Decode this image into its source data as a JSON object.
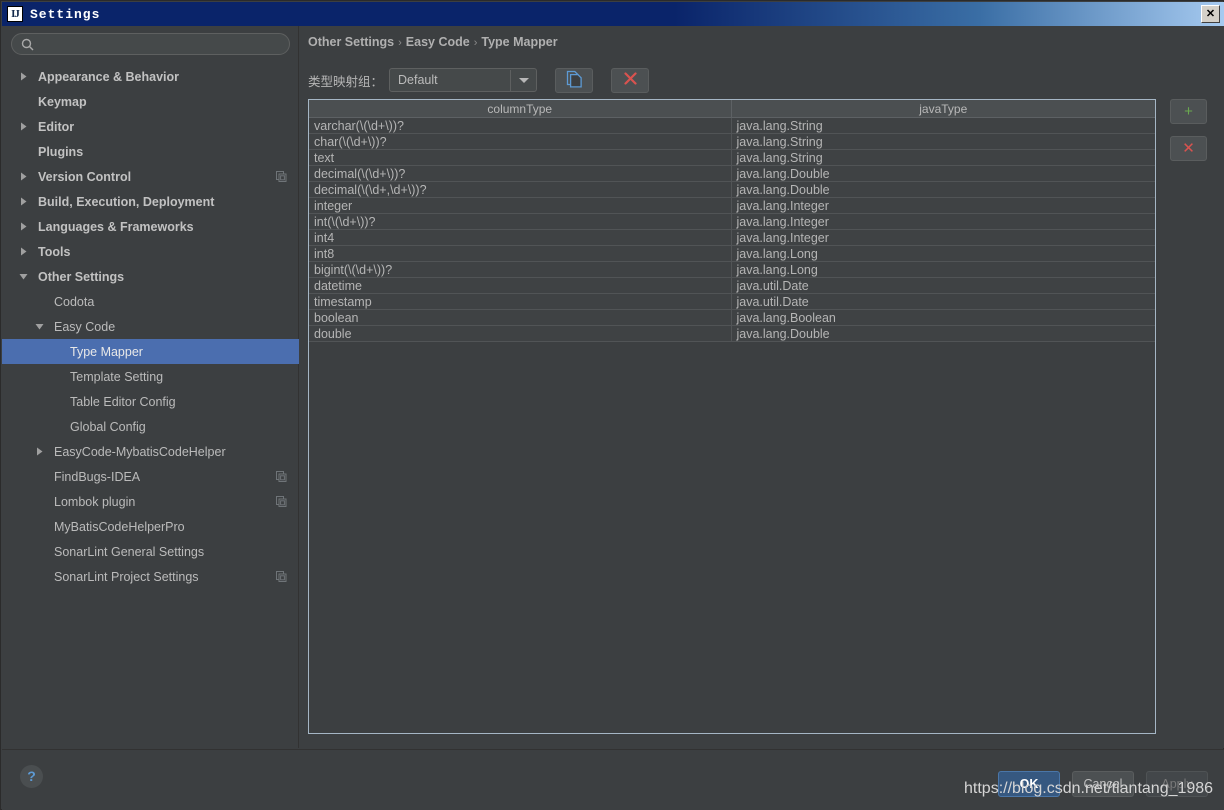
{
  "window": {
    "title": "Settings",
    "app_icon": "intellij-idea-icon",
    "close_label": "✕"
  },
  "sidebar": {
    "search": {
      "value": "",
      "placeholder": "",
      "icon": "search-icon"
    },
    "items": [
      {
        "label": "Appearance & Behavior",
        "indent": 36,
        "arrow": "collapsed",
        "bold": true,
        "badge": false
      },
      {
        "label": "Keymap",
        "indent": 36,
        "arrow": "none",
        "bold": true,
        "badge": false
      },
      {
        "label": "Editor",
        "indent": 36,
        "arrow": "collapsed",
        "bold": true,
        "badge": false
      },
      {
        "label": "Plugins",
        "indent": 36,
        "arrow": "none",
        "bold": true,
        "badge": false
      },
      {
        "label": "Version Control",
        "indent": 36,
        "arrow": "collapsed",
        "bold": true,
        "badge": true
      },
      {
        "label": "Build, Execution, Deployment",
        "indent": 36,
        "arrow": "collapsed",
        "bold": true,
        "badge": false
      },
      {
        "label": "Languages & Frameworks",
        "indent": 36,
        "arrow": "collapsed",
        "bold": true,
        "badge": false
      },
      {
        "label": "Tools",
        "indent": 36,
        "arrow": "collapsed",
        "bold": true,
        "badge": false
      },
      {
        "label": "Other Settings",
        "indent": 36,
        "arrow": "expanded",
        "bold": true,
        "badge": false
      },
      {
        "label": "Codota",
        "indent": 52,
        "arrow": "none",
        "bold": false,
        "badge": false
      },
      {
        "label": "Easy Code",
        "indent": 52,
        "arrow": "expanded",
        "bold": false,
        "badge": false
      },
      {
        "label": "Type Mapper",
        "indent": 68,
        "arrow": "none",
        "bold": false,
        "badge": false,
        "selected": true
      },
      {
        "label": "Template Setting",
        "indent": 68,
        "arrow": "none",
        "bold": false,
        "badge": false
      },
      {
        "label": "Table Editor Config",
        "indent": 68,
        "arrow": "none",
        "bold": false,
        "badge": false
      },
      {
        "label": "Global Config",
        "indent": 68,
        "arrow": "none",
        "bold": false,
        "badge": false
      },
      {
        "label": "EasyCode-MybatisCodeHelper",
        "indent": 52,
        "arrow": "collapsed",
        "bold": false,
        "badge": false
      },
      {
        "label": "FindBugs-IDEA",
        "indent": 52,
        "arrow": "none",
        "bold": false,
        "badge": true
      },
      {
        "label": "Lombok plugin",
        "indent": 52,
        "arrow": "none",
        "bold": false,
        "badge": true
      },
      {
        "label": "MyBatisCodeHelperPro",
        "indent": 52,
        "arrow": "none",
        "bold": false,
        "badge": false
      },
      {
        "label": "SonarLint General Settings",
        "indent": 52,
        "arrow": "none",
        "bold": false,
        "badge": false
      },
      {
        "label": "SonarLint Project Settings",
        "indent": 52,
        "arrow": "none",
        "bold": false,
        "badge": true
      }
    ]
  },
  "main": {
    "breadcrumb": [
      "Other Settings",
      "Easy Code",
      "Type Mapper"
    ],
    "breadcrumb_separator": "›",
    "toolbar": {
      "group_label": "类型映射组：",
      "group_value": "Default",
      "group_options": [
        "Default"
      ],
      "copy_icon": "copy-pages-icon",
      "delete_icon": "close-x-icon",
      "delete_label": "✕"
    },
    "table": {
      "columns": [
        "columnType",
        "javaType"
      ],
      "rows": [
        [
          "varchar(\\(\\d+\\))?",
          "java.lang.String"
        ],
        [
          "char(\\(\\d+\\))?",
          "java.lang.String"
        ],
        [
          "text",
          "java.lang.String"
        ],
        [
          "decimal(\\(\\d+\\))?",
          "java.lang.Double"
        ],
        [
          "decimal(\\(\\d+,\\d+\\))?",
          "java.lang.Double"
        ],
        [
          "integer",
          "java.lang.Integer"
        ],
        [
          "int(\\(\\d+\\))?",
          "java.lang.Integer"
        ],
        [
          "int4",
          "java.lang.Integer"
        ],
        [
          "int8",
          "java.lang.Long"
        ],
        [
          "bigint(\\(\\d+\\))?",
          "java.lang.Long"
        ],
        [
          "datetime",
          "java.util.Date"
        ],
        [
          "timestamp",
          "java.util.Date"
        ],
        [
          "boolean",
          "java.lang.Boolean"
        ],
        [
          "double",
          "java.lang.Double"
        ]
      ]
    },
    "side_buttons": {
      "add_label": "+",
      "remove_label": "✕"
    }
  },
  "footer": {
    "help_label": "?",
    "ok_label": "OK",
    "cancel_label": "Cancel",
    "apply_label": "Apply"
  },
  "watermark": "https://blog.csdn.net/tiantang_1986",
  "colors": {
    "background": "#3c3f41",
    "selection": "#4b6eaf",
    "titlebar": "#0a246a",
    "accent_ok": "#365880",
    "add_green": "#6aa84f",
    "remove_red": "#d9534f",
    "copy_blue": "#5d9ad4",
    "table_border": "#a5b6c5"
  }
}
